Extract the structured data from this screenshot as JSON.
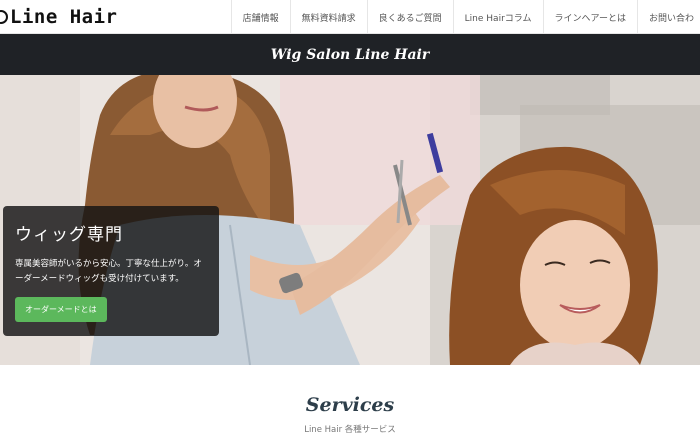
{
  "header": {
    "logo_text": "Line Hair",
    "nav": [
      "店舗情報",
      "無料資料請求",
      "良くあるご質問",
      "Line Hairコラム",
      "ラインヘアーとは",
      "お問い合わ"
    ]
  },
  "titlebar": {
    "text": "Wig Salon Line Hair"
  },
  "hero": {
    "heading": "ウィッグ専門",
    "text": "専属美容師がいるから安心。丁寧な仕上がり。オーダーメードウィッグも受け付けています。",
    "button": "オーダーメードとは"
  },
  "services": {
    "title": "Services",
    "subtitle": "Line Hair 各種サービス"
  }
}
